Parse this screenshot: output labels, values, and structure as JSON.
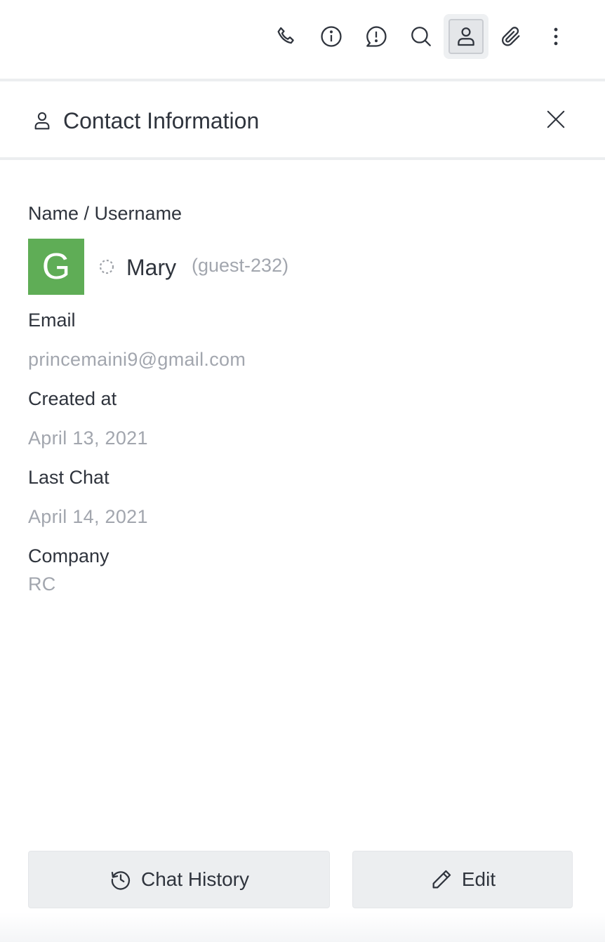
{
  "toolbar": {
    "buttons": [
      {
        "icon": "phone-icon"
      },
      {
        "icon": "info-icon"
      },
      {
        "icon": "discussion-alert-icon"
      },
      {
        "icon": "search-icon"
      },
      {
        "icon": "user-icon",
        "active": true
      },
      {
        "icon": "paperclip-icon"
      },
      {
        "icon": "kebab-menu-icon"
      }
    ]
  },
  "panel": {
    "icon": "user-icon",
    "title": "Contact Information",
    "close_icon": "close-icon"
  },
  "contact": {
    "name_label": "Name / Username",
    "avatar_letter": "G",
    "avatar_color": "#5fad56",
    "status_icon": "status-offline-icon",
    "name": "Mary",
    "username": "(guest-232)",
    "email_label": "Email",
    "email": "princemaini9@gmail.com",
    "created_label": "Created at",
    "created": "April 13, 2021",
    "last_chat_label": "Last Chat",
    "last_chat": "April 14, 2021",
    "company_label": "Company",
    "company": "RC"
  },
  "footer": {
    "history_label": "Chat History",
    "history_icon": "history-icon",
    "edit_label": "Edit",
    "edit_icon": "pencil-icon"
  },
  "colors": {
    "text": "#2f343d",
    "muted": "#a2a6ae",
    "button_bg": "#eceef0"
  }
}
